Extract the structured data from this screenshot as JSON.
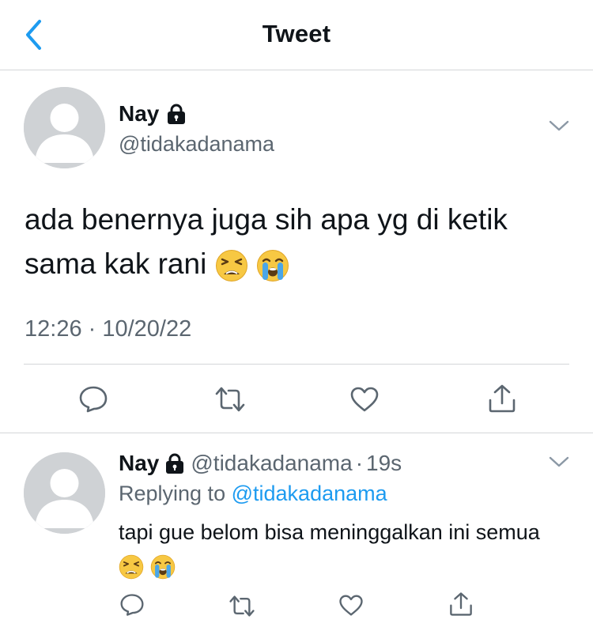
{
  "header": {
    "title": "Tweet",
    "back_icon": "chevron-left-icon"
  },
  "main_tweet": {
    "name": "Nay",
    "handle": "@tidakadanama",
    "text": "ada benernya juga sih apa yg di ketik sama kak rani",
    "emojis": [
      "tired-face-emoji",
      "loudly-crying-face-emoji"
    ],
    "timestamp": "12:26 · 10/20/22"
  },
  "reply": {
    "name": "Nay",
    "handle": "@tidakadanama",
    "dot": "·",
    "time": "19s",
    "replying_prefix": "Replying to",
    "replying_handle": "@tidakadanama",
    "text": "tapi gue belom bisa meninggalkan ini semua",
    "emojis": [
      "tired-face-emoji",
      "loudly-crying-face-emoji"
    ]
  },
  "actions": [
    "reply-icon",
    "retweet-icon",
    "like-icon",
    "share-icon"
  ],
  "colors": {
    "link": "#1d9bf0",
    "secondary_text": "#5b6670",
    "back_accent": "#1d9bf0",
    "divider": "#d4d6d9"
  }
}
